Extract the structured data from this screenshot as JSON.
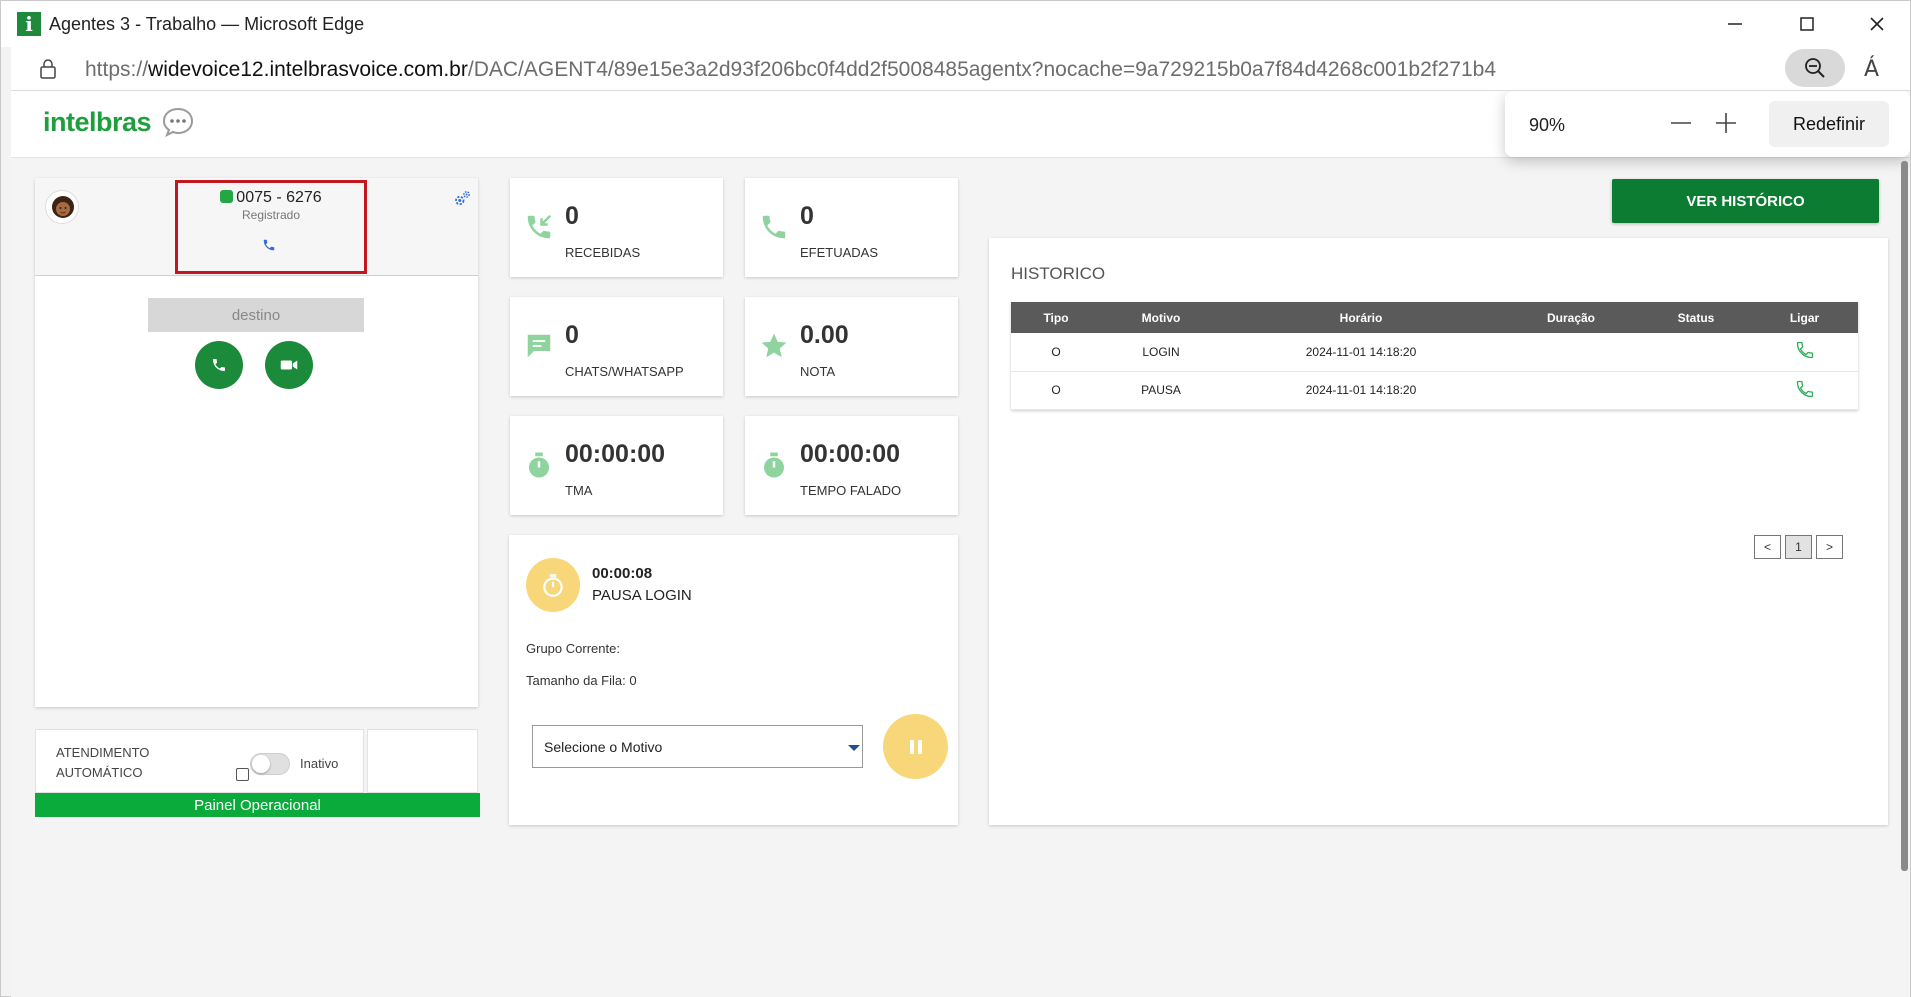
{
  "window": {
    "title": "Agentes 3 - Trabalho — Microsoft Edge",
    "app_icon_letter": "i"
  },
  "address_bar": {
    "url_prefix": "https://",
    "url_host": "widevoice12.intelbrasvoice.com.br",
    "url_path": "/DAC/AGENT4/89e15e3a2d93f206bc0f4dd2f5008485agentx?nocache=9a729215b0a7f84d4268c001b2f271b4",
    "read_aloud_glyph": "Á"
  },
  "zoom_popup": {
    "value": "90%",
    "reset_label": "Redefinir"
  },
  "header": {
    "logo_text": "intelbras"
  },
  "phone_panel": {
    "extension": "0075 - 6276",
    "status": "Registrado",
    "destination_placeholder": "destino"
  },
  "auto_attendance": {
    "label_line1": "ATENDIMENTO",
    "label_line2": "AUTOMÁTICO",
    "state_label": "Inativo",
    "enabled": false
  },
  "operational_panel_label": "Painel Operacional",
  "stats": {
    "recebidas": {
      "value": "0",
      "label": "RECEBIDAS"
    },
    "efetuadas": {
      "value": "0",
      "label": "EFETUADAS"
    },
    "chats": {
      "value": "0",
      "label": "CHATS/WHATSAPP"
    },
    "nota": {
      "value": "0.00",
      "label": "NOTA"
    },
    "tma": {
      "value": "00:00:00",
      "label": "TMA"
    },
    "tempo_falado": {
      "value": "00:00:00",
      "label": "TEMPO FALADO"
    }
  },
  "pause": {
    "elapsed": "00:00:08",
    "name": "PAUSA LOGIN",
    "grupo_label": "Grupo Corrente:",
    "fila_label": "Tamanho da Fila: 0",
    "select_label": "Selecione o Motivo"
  },
  "history": {
    "button_label": "VER HISTÓRICO",
    "title": "HISTORICO",
    "columns": [
      "Tipo",
      "Motivo",
      "Horário",
      "Duração",
      "Status",
      "Ligar"
    ],
    "rows": [
      {
        "tipo": "O",
        "motivo": "LOGIN",
        "horario": "2024-11-01 14:18:20",
        "duracao": "",
        "status": ""
      },
      {
        "tipo": "O",
        "motivo": "PAUSA",
        "horario": "2024-11-01 14:18:20",
        "duracao": "",
        "status": ""
      }
    ],
    "pager": {
      "prev": "<",
      "page": "1",
      "next": ">"
    }
  },
  "colors": {
    "brand_green": "#1f9e3e",
    "button_green": "#0d7c33",
    "panel_green": "#0aaa3b",
    "pause_yellow": "#f8d77a",
    "highlight_red": "#c1181f",
    "icon_green_light": "#8fd39e"
  }
}
